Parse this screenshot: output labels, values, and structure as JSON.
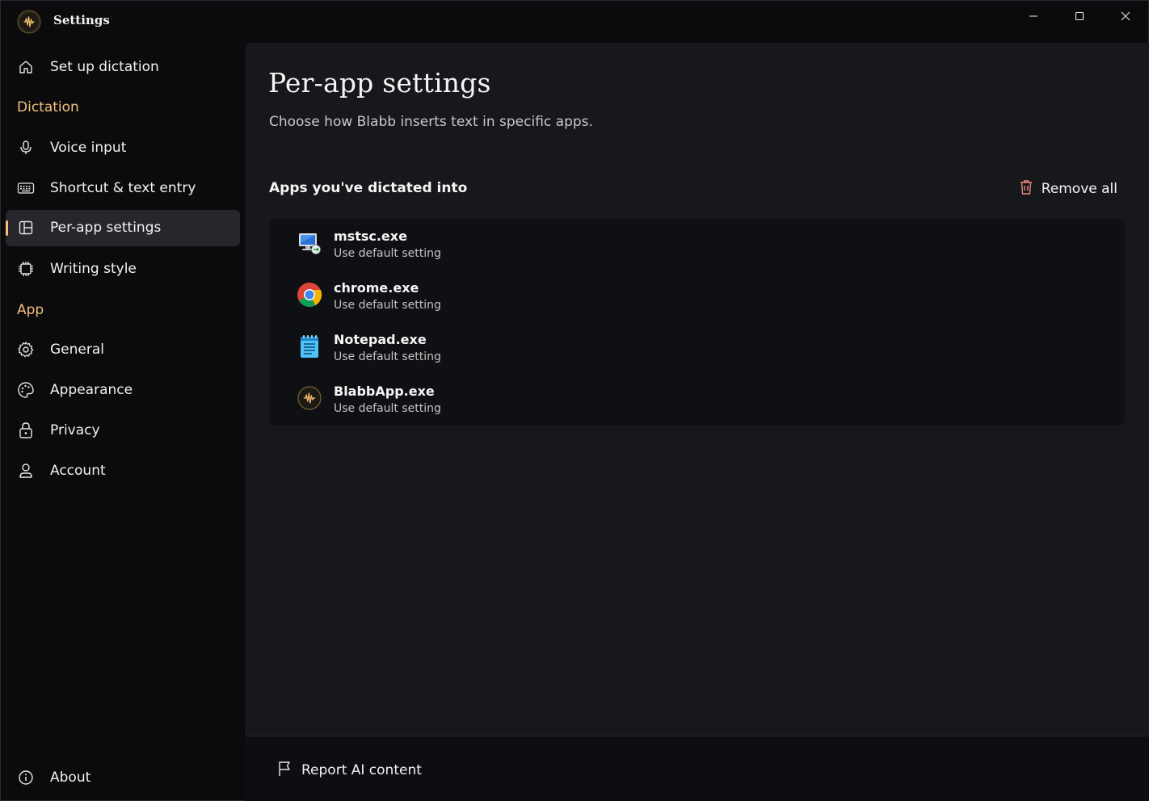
{
  "window": {
    "title": "Settings",
    "controls": [
      "minimize-icon",
      "maximize-icon",
      "close-icon"
    ]
  },
  "sidebar": {
    "top_item": {
      "label": "Set up dictation",
      "icon": "home-icon"
    },
    "sections": [
      {
        "header": "Dictation",
        "items": [
          {
            "label": "Voice input",
            "icon": "microphone-icon"
          },
          {
            "label": "Shortcut & text entry",
            "icon": "keyboard-icon"
          },
          {
            "label": "Per-app settings",
            "icon": "app-panels-icon",
            "active": true
          },
          {
            "label": "Writing style",
            "icon": "chip-icon"
          }
        ]
      },
      {
        "header": "App",
        "items": [
          {
            "label": "General",
            "icon": "gear-icon"
          },
          {
            "label": "Appearance",
            "icon": "palette-icon"
          },
          {
            "label": "Privacy",
            "icon": "lock-icon"
          },
          {
            "label": "Account",
            "icon": "person-icon"
          }
        ]
      }
    ],
    "bottom_item": {
      "label": "About",
      "icon": "info-icon"
    }
  },
  "main": {
    "title": "Per-app settings",
    "subtitle": "Choose how Blabb inserts text in specific apps.",
    "section_title": "Apps you've dictated into",
    "remove_all_label": "Remove all",
    "apps": [
      {
        "name": "mstsc.exe",
        "setting": "Use default setting",
        "icon": "remote-desktop-icon"
      },
      {
        "name": "chrome.exe",
        "setting": "Use default setting",
        "icon": "chrome-icon"
      },
      {
        "name": "Notepad.exe",
        "setting": "Use default setting",
        "icon": "notepad-icon"
      },
      {
        "name": "BlabbApp.exe",
        "setting": "Use default setting",
        "icon": "blabb-icon"
      }
    ]
  },
  "footer": {
    "report_label": "Report AI content",
    "report_icon": "flag-icon"
  },
  "colors": {
    "accent": "#f1c27d",
    "background": "#0b0b0d",
    "panel": "#17181b",
    "list_bg": "#0f1013",
    "danger_icon": "#f28b82"
  }
}
